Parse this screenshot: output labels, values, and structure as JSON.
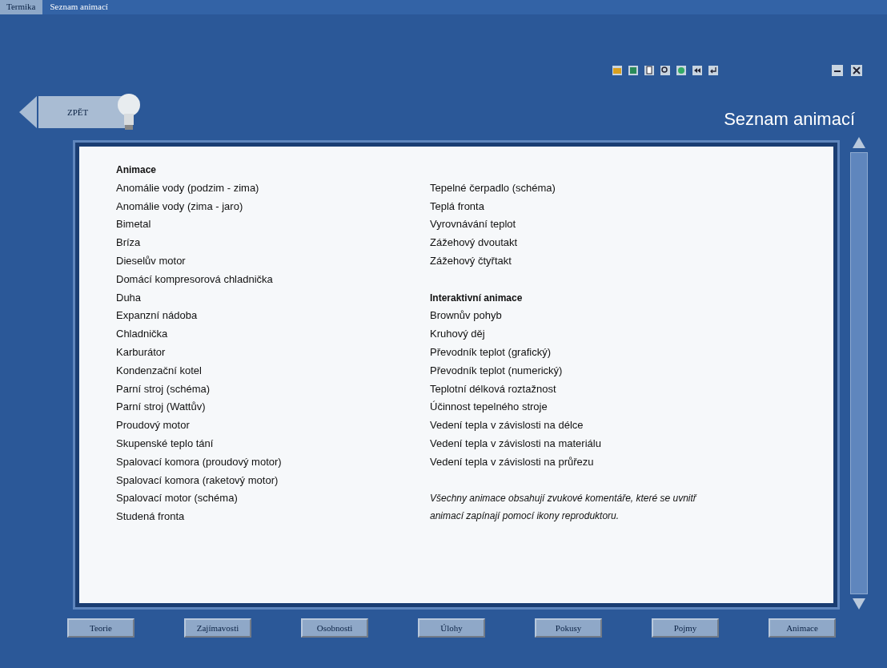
{
  "breadcrumb": [
    {
      "label": "Termika",
      "selected": false
    },
    {
      "label": "Seznam animací",
      "selected": true
    }
  ],
  "back_button": "ZPĚT",
  "page_title": "Seznam animací",
  "left_column": {
    "heading": "Animace",
    "items": [
      "Anomálie vody (podzim - zima)",
      "Anomálie vody (zima - jaro)",
      "Bimetal",
      "Bríza",
      "Dieselův motor",
      "Domácí kompresorová chladnička",
      "Duha",
      "Expanzní nádoba",
      "Chladnička",
      "Karburátor",
      "Kondenzační kotel",
      "Parní stroj (schéma)",
      "Parní stroj (Wattův)",
      "Proudový motor",
      "Skupenské teplo tání",
      "Spalovací komora (proudový motor)",
      "Spalovací komora (raketový motor)",
      "Spalovací motor (schéma)",
      "Studená fronta"
    ]
  },
  "right_column": {
    "items": [
      "Tepelné čerpadlo (schéma)",
      "Teplá fronta",
      "Vyrovnávání teplot",
      "Zážehový dvoutakt",
      "Zážehový čtyřtakt"
    ],
    "interactive_heading": "Interaktivní animace",
    "interactive_items": [
      "Brownův pohyb",
      "Kruhový děj",
      "Převodník teplot (grafický)",
      "Převodník teplot (numerický)",
      "Teplotní délková roztažnost",
      "Účinnost tepelného stroje",
      "Vedení tepla v závislosti na délce",
      "Vedení tepla v závislosti na materiálu",
      "Vedení tepla v závislosti na průřezu"
    ],
    "note": "Všechny animace obsahují zvukové komentáře, které se uvnitř animací zapínají pomocí ikony reproduktoru."
  },
  "nav_buttons": [
    "Teorie",
    "Zajímavosti",
    "Osobnosti",
    "Úlohy",
    "Pokusy",
    "Pojmy",
    "Animace"
  ]
}
